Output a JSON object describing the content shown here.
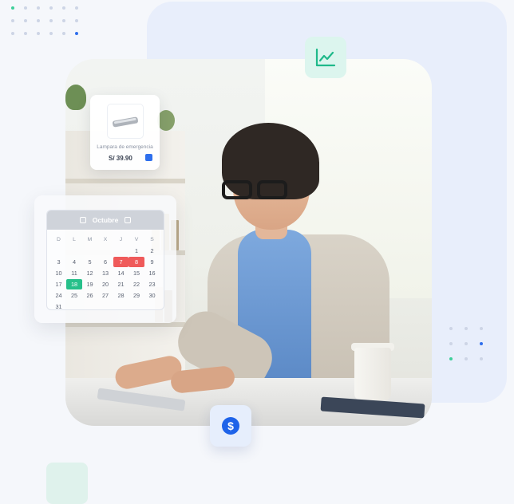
{
  "colors": {
    "accent_blue": "#1e63e9",
    "accent_green": "#27c08a",
    "accent_red": "#ef5a5a",
    "card_bg": "#e8eefb"
  },
  "icons": {
    "chart": "trend-chart-icon",
    "dollar": "dollar-icon",
    "cart": "cart-icon"
  },
  "product": {
    "name": "Lampara de emergencia",
    "price": "S/ 39.90"
  },
  "calendar": {
    "month": "Octubre",
    "weekdays": [
      "D",
      "L",
      "M",
      "X",
      "J",
      "V",
      "S"
    ],
    "days": [
      "",
      "",
      "",
      "",
      "",
      "1",
      "2",
      "3",
      "4",
      "5",
      "6",
      "7",
      "8",
      "9",
      "10",
      "11",
      "12",
      "13",
      "14",
      "15",
      "16",
      "17",
      "18",
      "19",
      "20",
      "21",
      "22",
      "23",
      "24",
      "25",
      "26",
      "27",
      "28",
      "29",
      "30",
      "31"
    ],
    "highlighted_red": [
      "7",
      "8"
    ],
    "highlighted_green": [
      "18"
    ]
  },
  "dollar_symbol": "$"
}
